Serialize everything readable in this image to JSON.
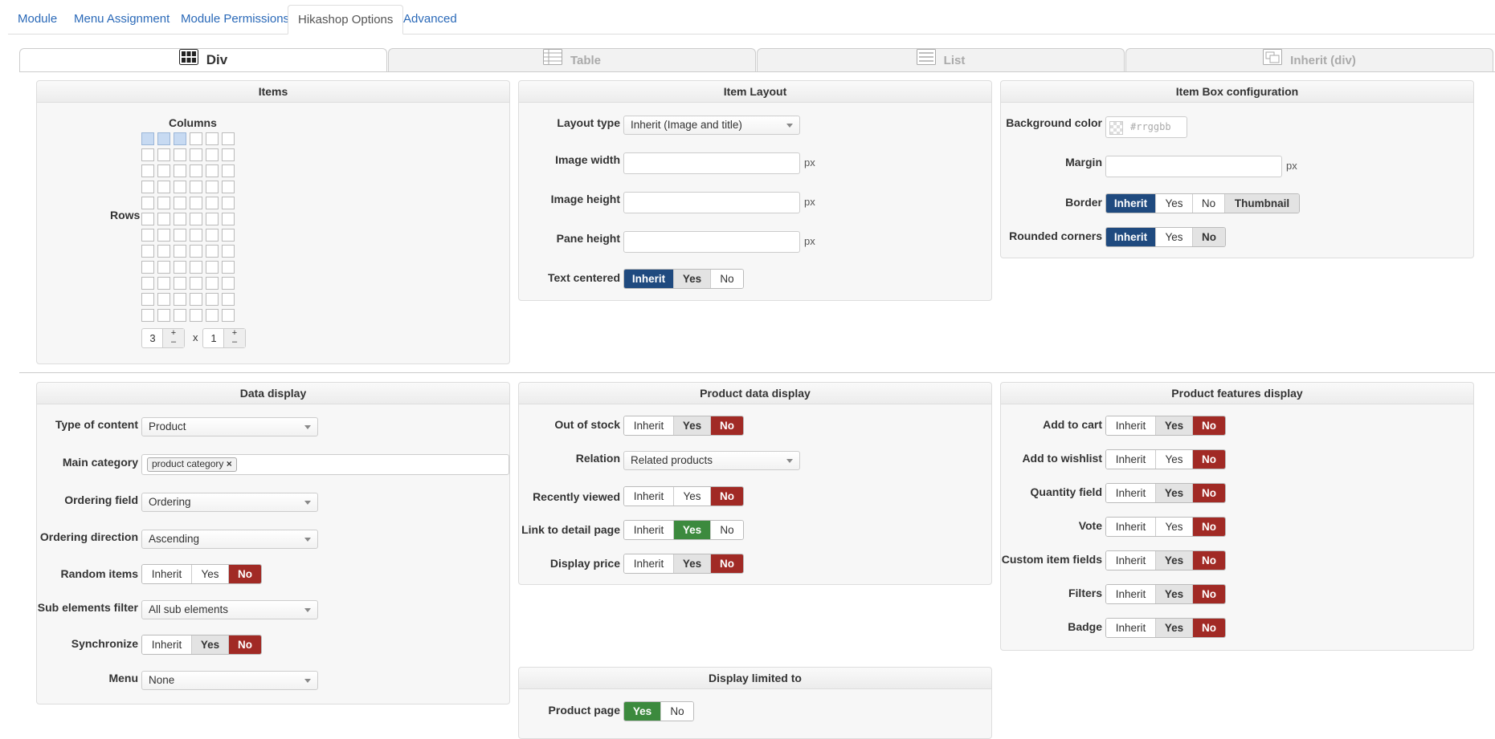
{
  "top_tabs": [
    "Module",
    "Menu Assignment",
    "Module Permissions",
    "Hikashop Options",
    "Advanced"
  ],
  "layout_tabs": [
    "Div",
    "Table",
    "List",
    "Inherit (div)"
  ],
  "items": {
    "title": "Items",
    "columns_label": "Columns",
    "rows_label": "Rows",
    "columns_value": "3",
    "rows_value": "1",
    "times": "x",
    "plus": "+",
    "minus": "–"
  },
  "item_layout": {
    "title": "Item Layout",
    "layout_type_label": "Layout type",
    "layout_type_value": "Inherit (Image and title)",
    "image_width_label": "Image width",
    "image_height_label": "Image height",
    "pane_height_label": "Pane height",
    "px": "px",
    "text_centered_label": "Text centered",
    "opts3": [
      "Inherit",
      "Yes",
      "No"
    ]
  },
  "item_box": {
    "title": "Item Box configuration",
    "bg_color_label": "Background color",
    "bg_color_placeholder": "#rrggbb",
    "margin_label": "Margin",
    "border_label": "Border",
    "border_opts": [
      "Inherit",
      "Yes",
      "No",
      "Thumbnail"
    ],
    "rounded_label": "Rounded corners"
  },
  "data_display": {
    "title": "Data display",
    "type_label": "Type of content",
    "type_value": "Product",
    "main_cat_label": "Main category",
    "main_cat_tag": "product category",
    "ordering_field_label": "Ordering field",
    "ordering_field_value": "Ordering",
    "ordering_dir_label": "Ordering direction",
    "ordering_dir_value": "Ascending",
    "random_label": "Random items",
    "sub_filter_label": "Sub elements filter",
    "sub_filter_value": "All sub elements",
    "sync_label": "Synchronize",
    "menu_label": "Menu",
    "menu_value": "None"
  },
  "product_data": {
    "title": "Product data display",
    "out_of_stock_label": "Out of stock",
    "relation_label": "Relation",
    "relation_value": "Related products",
    "recently_label": "Recently viewed",
    "link_label": "Link to detail page",
    "price_label": "Display price"
  },
  "features": {
    "title": "Product features display",
    "rows": [
      "Add to cart",
      "Add to wishlist",
      "Quantity field",
      "Vote",
      "Custom item fields",
      "Filters",
      "Badge"
    ]
  },
  "limited": {
    "title": "Display limited to",
    "product_page_label": "Product page",
    "opts2": [
      "Yes",
      "No"
    ]
  },
  "colors": {
    "blue": "#1f4a7f",
    "red": "#a12a25",
    "green": "#3c8a3e",
    "link": "#2a69b8"
  }
}
